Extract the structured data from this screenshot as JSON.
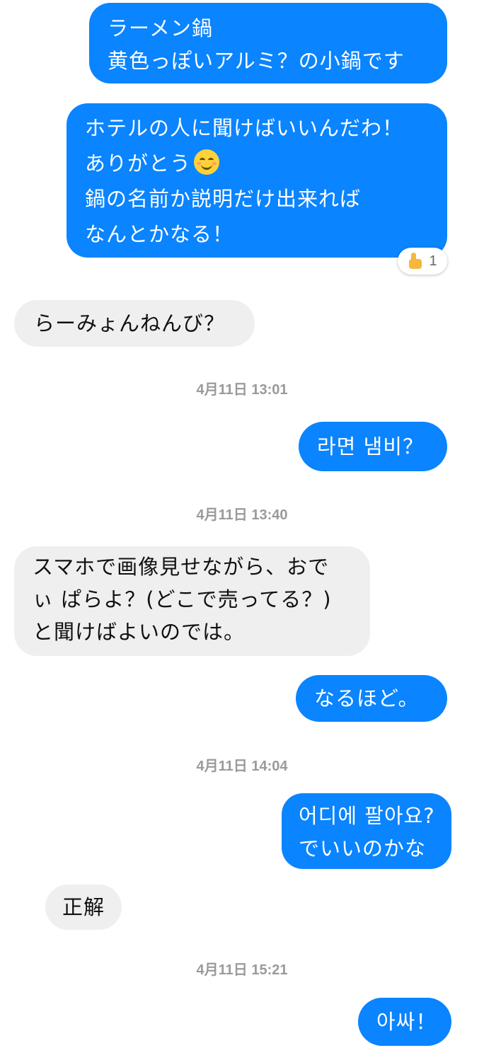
{
  "messages": [
    {
      "lines": [
        "ラーメン鍋",
        "黄色っぽいアルミ？の小鍋です"
      ]
    },
    {
      "lines": [
        "ホテルの人に聞けばいいんだわ！",
        "ありがとう",
        "鍋の名前か説明だけ出来れば",
        "なんとかなる！"
      ],
      "emoji": "smiling-face-emoji",
      "reaction": {
        "icon": "thumbs-up-icon",
        "count": "1"
      }
    },
    {
      "lines": [
        "らーみょんねんび？"
      ]
    },
    {
      "timestamp": "4月11日 13:01"
    },
    {
      "lines": [
        "라면 냄비？"
      ]
    },
    {
      "timestamp": "4月11日 13:40"
    },
    {
      "lines": [
        "スマホで画像見せながら、おで",
        "ぃ ぱらよ？(どこで売ってる？)",
        "と聞けばよいのでは。"
      ]
    },
    {
      "lines": [
        "なるほど。"
      ]
    },
    {
      "timestamp": "4月11日 14:04"
    },
    {
      "lines": [
        "어디에 팔아요?",
        "でいいのかな"
      ]
    },
    {
      "lines": [
        "正解"
      ]
    },
    {
      "timestamp": "4月11日 15:21"
    },
    {
      "lines": [
        "아싸！"
      ]
    }
  ],
  "colors": {
    "outgoing_bubble": "#0a84ff",
    "incoming_bubble": "#efefef",
    "timestamp_text": "#9a9a9a"
  }
}
